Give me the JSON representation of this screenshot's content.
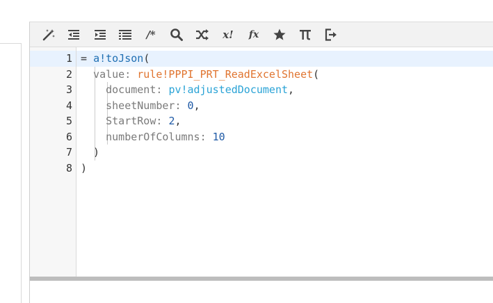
{
  "toolbar": {
    "buttons": [
      {
        "icon": "magic-wand-icon"
      },
      {
        "icon": "outdent-icon"
      },
      {
        "icon": "indent-icon"
      },
      {
        "icon": "list-icon"
      },
      {
        "icon": "comment-icon",
        "text": "/*"
      },
      {
        "icon": "search-icon"
      },
      {
        "icon": "shuffle-icon"
      },
      {
        "icon": "variable-icon",
        "text": "x!"
      },
      {
        "icon": "function-icon",
        "text": "fx"
      },
      {
        "icon": "star-icon"
      },
      {
        "icon": "pi-icon"
      },
      {
        "icon": "exit-icon"
      }
    ]
  },
  "editor": {
    "line_numbers": [
      "1",
      "2",
      "3",
      "4",
      "5",
      "6",
      "7",
      "8"
    ],
    "lines": [
      [
        {
          "t": "= ",
          "c": "punct"
        },
        {
          "t": "a!toJson",
          "c": "func"
        },
        {
          "t": "(",
          "c": "punct"
        }
      ],
      [
        {
          "t": "  value: ",
          "c": "param"
        },
        {
          "t": "rule!PPPI_PRT_ReadExcelSheet",
          "c": "rule"
        },
        {
          "t": "(",
          "c": "punct"
        }
      ],
      [
        {
          "t": "    document: ",
          "c": "param"
        },
        {
          "t": "pv!adjustedDocument",
          "c": "var"
        },
        {
          "t": ",",
          "c": "punct"
        }
      ],
      [
        {
          "t": "    sheetNumber: ",
          "c": "param"
        },
        {
          "t": "0",
          "c": "num"
        },
        {
          "t": ",",
          "c": "punct"
        }
      ],
      [
        {
          "t": "    StartRow: ",
          "c": "param"
        },
        {
          "t": "2",
          "c": "num"
        },
        {
          "t": ",",
          "c": "punct"
        }
      ],
      [
        {
          "t": "    numberOfColumns: ",
          "c": "param"
        },
        {
          "t": "10",
          "c": "num"
        }
      ],
      [
        {
          "t": "  )",
          "c": "punct"
        }
      ],
      [
        {
          "t": ")",
          "c": "punct"
        }
      ]
    ]
  },
  "colors": {
    "function": "#1f6fb3",
    "parameter": "#7a7a7a",
    "rule": "#e0742f",
    "variable": "#2aa3d6",
    "number": "#1f5aa6",
    "active_line": "#e8f2fe"
  }
}
